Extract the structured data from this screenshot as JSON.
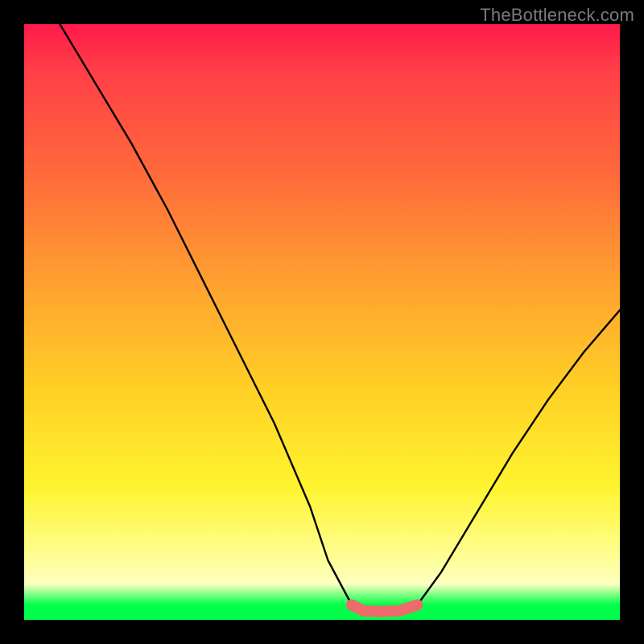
{
  "watermark": "TheBottleneck.com",
  "chart_data": {
    "type": "line",
    "title": "",
    "xlabel": "",
    "ylabel": "",
    "xlim": [
      0,
      100
    ],
    "ylim": [
      0,
      100
    ],
    "grid": false,
    "note": "No numeric axes shown; x/y are normalized 0-100 estimates read from pixel positions.",
    "series": [
      {
        "name": "main-curve",
        "color": "#000000",
        "x": [
          6,
          12,
          18,
          24,
          30,
          36,
          42,
          48,
          51,
          55,
          57,
          60,
          63,
          66,
          70,
          76,
          82,
          88,
          94,
          100
        ],
        "y": [
          100,
          90,
          80,
          69,
          57,
          45,
          33,
          19,
          10,
          2.5,
          1.5,
          1.4,
          1.5,
          2.5,
          8,
          18,
          28,
          37,
          45,
          52
        ]
      },
      {
        "name": "bottom-highlight",
        "color": "#ef6b6b",
        "x": [
          55,
          57,
          60,
          63,
          66
        ],
        "y": [
          2.5,
          1.5,
          1.4,
          1.5,
          2.5
        ]
      }
    ]
  }
}
